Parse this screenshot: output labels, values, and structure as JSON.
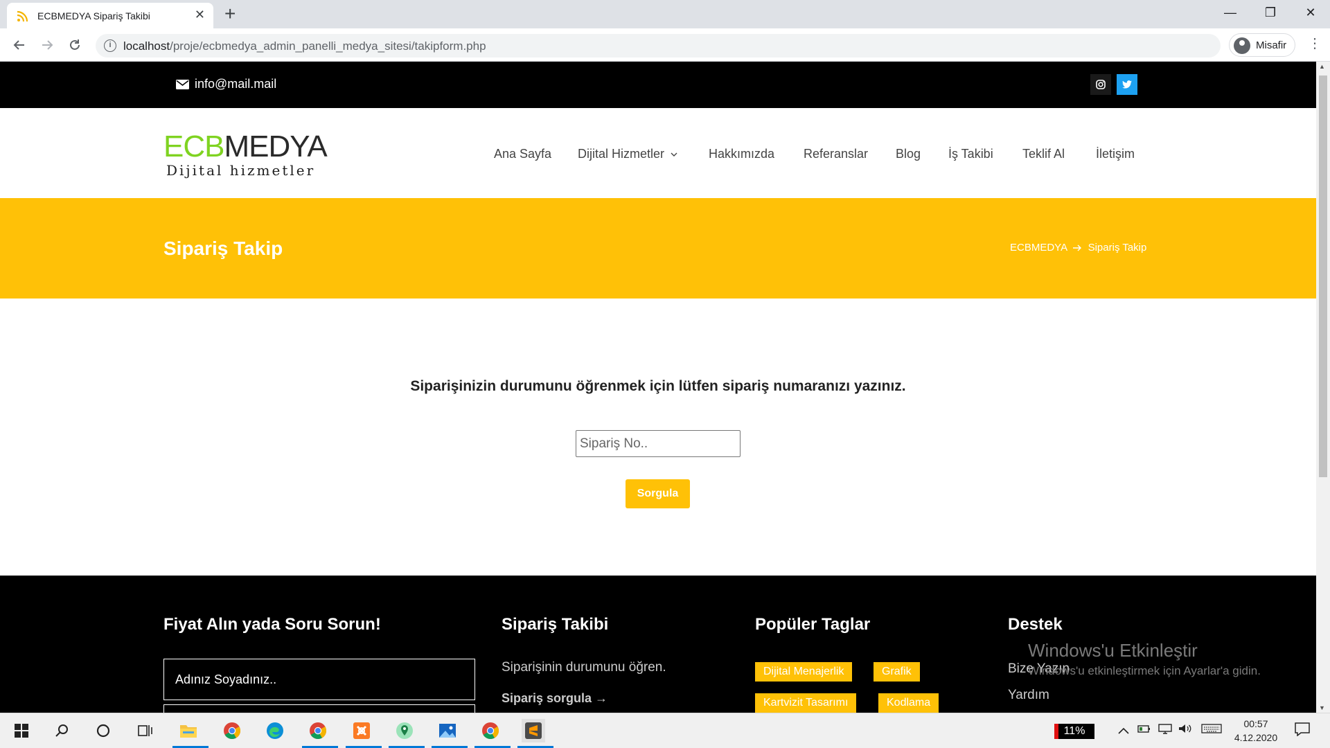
{
  "browser": {
    "tab_title": "ECBMEDYA Sipariş Takibi",
    "tab_close": "✕",
    "new_tab": "+",
    "url_host": "localhost",
    "url_path": "/proje/ecbmedya_admin_panelli_medya_sitesi/takipform.php",
    "profile_label": "Misafir",
    "window_minimize": "—",
    "window_restore": "❐",
    "window_close": "✕"
  },
  "topbar": {
    "email": "info@mail.mail",
    "social": [
      "instagram-icon",
      "twitter-icon"
    ]
  },
  "logo": {
    "part1": "ECB",
    "part2": "MEDYA",
    "tagline": "Dijital hizmetler"
  },
  "nav": {
    "items": [
      "Ana Sayfa",
      "Dijital Hizmetler",
      "Hakkımızda",
      "Referanslar",
      "Blog",
      "İş Takibi",
      "Teklif Al",
      "İletişim"
    ]
  },
  "banner": {
    "title": "Sipariş Takip",
    "breadcrumb_home": "ECBMEDYA",
    "breadcrumb_current": "Sipariş Takip"
  },
  "form": {
    "prompt": "Siparişinizin durumunu öğrenmek için lütfen sipariş numaranızı yazınız.",
    "placeholder": "Sipariş No..",
    "button": "Sorgula"
  },
  "footer": {
    "col1_title": "Fiyat Alın yada Soru Sorun!",
    "name_placeholder": "Adınız Soyadınız..",
    "col2_title": "Sipariş Takibi",
    "col2_text": "Siparişinin durumunu öğren.",
    "col2_link": "Sipariş sorgula →",
    "col3_title": "Popüler Taglar",
    "tags": [
      "Dijital Menajerlik",
      "Grafik",
      "Kartvizit Tasarımı",
      "Kodlama"
    ],
    "col4_title": "Destek",
    "col4_links": [
      "Bize Yazın",
      "Yardım"
    ]
  },
  "watermark": {
    "line1": "Windows'u Etkinleştir",
    "line2": "Windows'u etkinleştirmek için Ayarlar'a gidin."
  },
  "taskbar": {
    "battery": "11%",
    "time": "00:57",
    "date": "4.12.2020"
  },
  "colors": {
    "accent": "#ffc107",
    "logo_green": "#7fd321",
    "twitter": "#1da1f2",
    "topbar": "#000000"
  }
}
